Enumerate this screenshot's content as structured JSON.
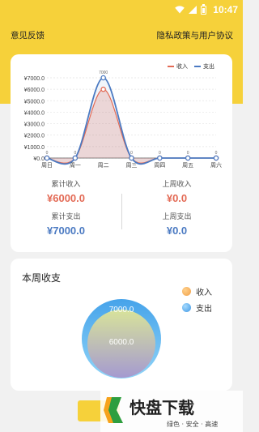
{
  "status_bar": {
    "time": "10:47"
  },
  "header": {
    "feedback_link": "意见反馈",
    "privacy_link": "隐私政策与用户协议"
  },
  "colors": {
    "income": "#e36a55",
    "expense": "#4b7ac2",
    "accent": "#f6d13a"
  },
  "chart_data": {
    "type": "line",
    "categories": [
      "周日",
      "周一",
      "周二",
      "周三",
      "周四",
      "周五",
      "周六"
    ],
    "y_ticks": [
      "¥0.0",
      "¥1000.0",
      "¥2000.0",
      "¥3000.0",
      "¥4000.0",
      "¥5000.0",
      "¥6000.0",
      "¥7000.0"
    ],
    "ylim": [
      0,
      7000
    ],
    "grid": true,
    "legend_position": "top-right",
    "series": [
      {
        "name": "收入",
        "values": [
          0,
          0,
          6000,
          0,
          0,
          0,
          0
        ],
        "color": "#e36a55",
        "point_labels": [
          "",
          "",
          "",
          "",
          "",
          "",
          ""
        ]
      },
      {
        "name": "支出",
        "values": [
          0,
          0,
          7000,
          0,
          0,
          0,
          0
        ],
        "color": "#4b7ac2",
        "point_labels": [
          "0",
          "0",
          "7000",
          "0",
          "0",
          "0",
          "0"
        ]
      }
    ]
  },
  "stats": {
    "cumulative_income_label": "累计收入",
    "cumulative_income_value": "¥6000.0",
    "cumulative_expense_label": "累计支出",
    "cumulative_expense_value": "¥7000.0",
    "last_week_income_label": "上周收入",
    "last_week_income_value": "¥0.0",
    "last_week_expense_label": "上周支出",
    "last_week_expense_value": "¥0.0"
  },
  "weekly": {
    "title": "本周收支",
    "legend_income": "收入",
    "legend_expense": "支出",
    "expense_value": "7000.0",
    "income_value": "6000.0",
    "expense_amount": 7000,
    "income_amount": 6000
  },
  "watermark": {
    "brand": "快盘下载",
    "slogan": "绿色 · 安全 · 高速"
  }
}
